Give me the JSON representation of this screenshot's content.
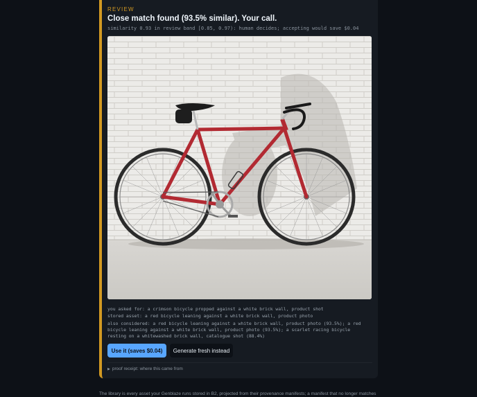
{
  "review": {
    "kicker": "REVIEW",
    "title": "Close match found (93.5% similar). Your call.",
    "subtitle": "similarity 0.93 in review band [0.85, 0.97): human decides; accepting would save $0.04",
    "image_alt": "red road bicycle leaning against a white brick wall",
    "asked": "you asked for: a crimson bicycle propped against a white brick wall, product shot",
    "stored": "stored asset: a red bicycle leaning against a white brick wall, product photo",
    "also": "also considered: a red bicycle leaning against a white brick wall, product photo (93.5%); a red bicycle leaning against a white brick wall, product photo (93.5%); a scarlet racing bicycle resting on a whitewashed brick wall, catalogue shot (88.4%)",
    "use_label": "Use it (saves $0.04)",
    "fresh_label": "Generate fresh instead",
    "receipt_label": "proof receipt: where this came from"
  },
  "footer": {
    "text": "The library is every asset your Genblaze runs stored in B2, projected from their provenance manifests; a manifest that no longer matches its own"
  },
  "colors": {
    "accent": "#d29922",
    "primary_button": "#58a6ff",
    "background": "#0d1117",
    "card": "#161b22"
  }
}
